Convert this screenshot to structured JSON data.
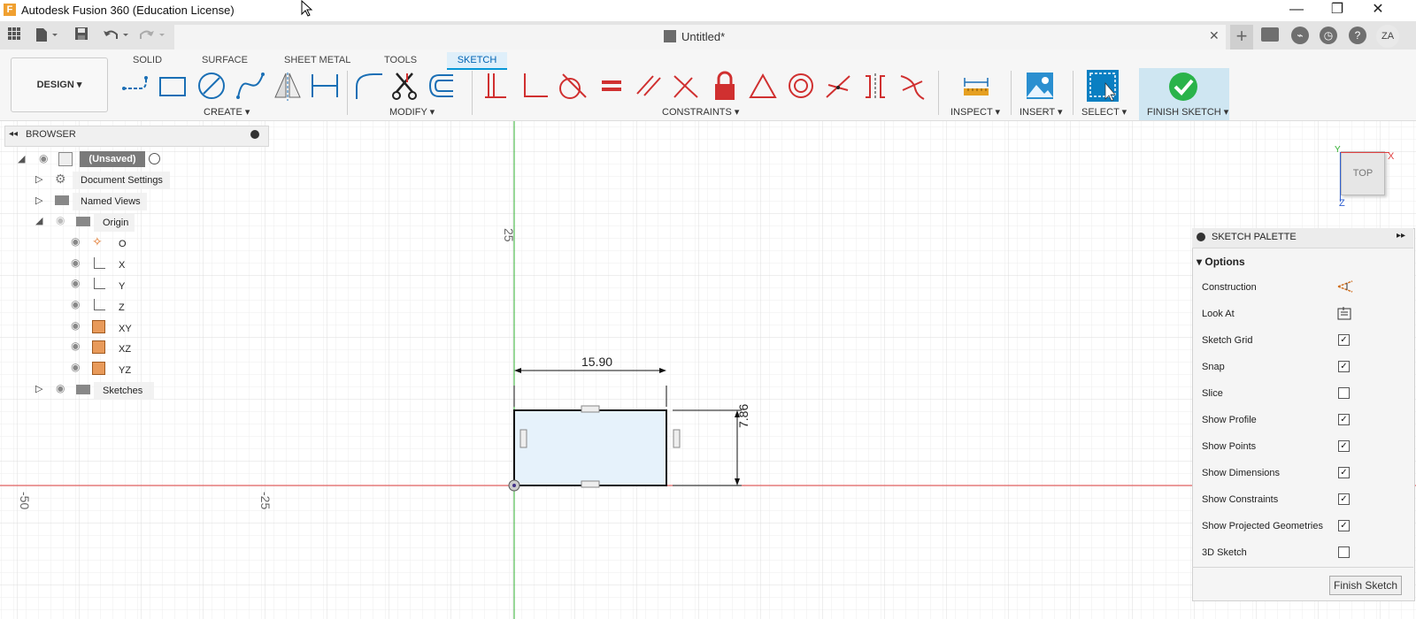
{
  "window": {
    "title": "Autodesk Fusion 360 (Education License)",
    "app_icon_letter": "F",
    "minimize_glyph": "—",
    "restore_glyph": "❐",
    "close_glyph": "✕"
  },
  "document": {
    "tab_title": "Untitled*",
    "close_glyph": "✕",
    "new_tab_glyph": "+"
  },
  "user": {
    "initials": "ZA"
  },
  "workspace": {
    "label": "DESIGN"
  },
  "tabs": [
    {
      "label": "SOLID"
    },
    {
      "label": "SURFACE"
    },
    {
      "label": "SHEET METAL"
    },
    {
      "label": "TOOLS"
    },
    {
      "label": "SKETCH",
      "active": true
    }
  ],
  "groups": {
    "create": "CREATE",
    "modify": "MODIFY",
    "constraints": "CONSTRAINTS",
    "inspect": "INSPECT",
    "insert": "INSERT",
    "select": "SELECT",
    "finish_sketch": "FINISH SKETCH"
  },
  "browser": {
    "title": "BROWSER",
    "items": [
      {
        "label": "(Unsaved)"
      },
      {
        "label": "Document Settings"
      },
      {
        "label": "Named Views"
      },
      {
        "label": "Origin"
      },
      {
        "label": "O"
      },
      {
        "label": "X"
      },
      {
        "label": "Y"
      },
      {
        "label": "Z"
      },
      {
        "label": "XY"
      },
      {
        "label": "XZ"
      },
      {
        "label": "YZ"
      },
      {
        "label": "Sketches"
      }
    ]
  },
  "canvas": {
    "axis_label_top": "25",
    "axis_label_left_far": "-50",
    "axis_label_left_near": "-25",
    "dimension_width": "15.90",
    "dimension_height": "7.86"
  },
  "viewcube": {
    "face": "TOP",
    "x_axis": "X",
    "y_axis": "Y",
    "z_axis": "Z"
  },
  "palette": {
    "title": "SKETCH PALETTE",
    "section": "Options",
    "options": [
      {
        "label": "Construction"
      },
      {
        "label": "Look At"
      },
      {
        "label": "Sketch Grid",
        "checked": true
      },
      {
        "label": "Snap",
        "checked": true
      },
      {
        "label": "Slice",
        "checked": false
      },
      {
        "label": "Show Profile",
        "checked": true
      },
      {
        "label": "Show Points",
        "checked": true
      },
      {
        "label": "Show Dimensions",
        "checked": true
      },
      {
        "label": "Show Constraints",
        "checked": true
      },
      {
        "label": "Show Projected Geometries",
        "checked": true
      },
      {
        "label": "3D Sketch",
        "checked": false
      }
    ],
    "finish_button": "Finish Sketch"
  },
  "colors": {
    "accent": "#0696d7",
    "constraint_red": "#d03030",
    "finish_green": "#2ab34a",
    "x_axis_red": "#e04040",
    "y_axis_green": "#30b030",
    "grid": "#e8e8e8",
    "profile_fill": "#e6f2fb"
  }
}
